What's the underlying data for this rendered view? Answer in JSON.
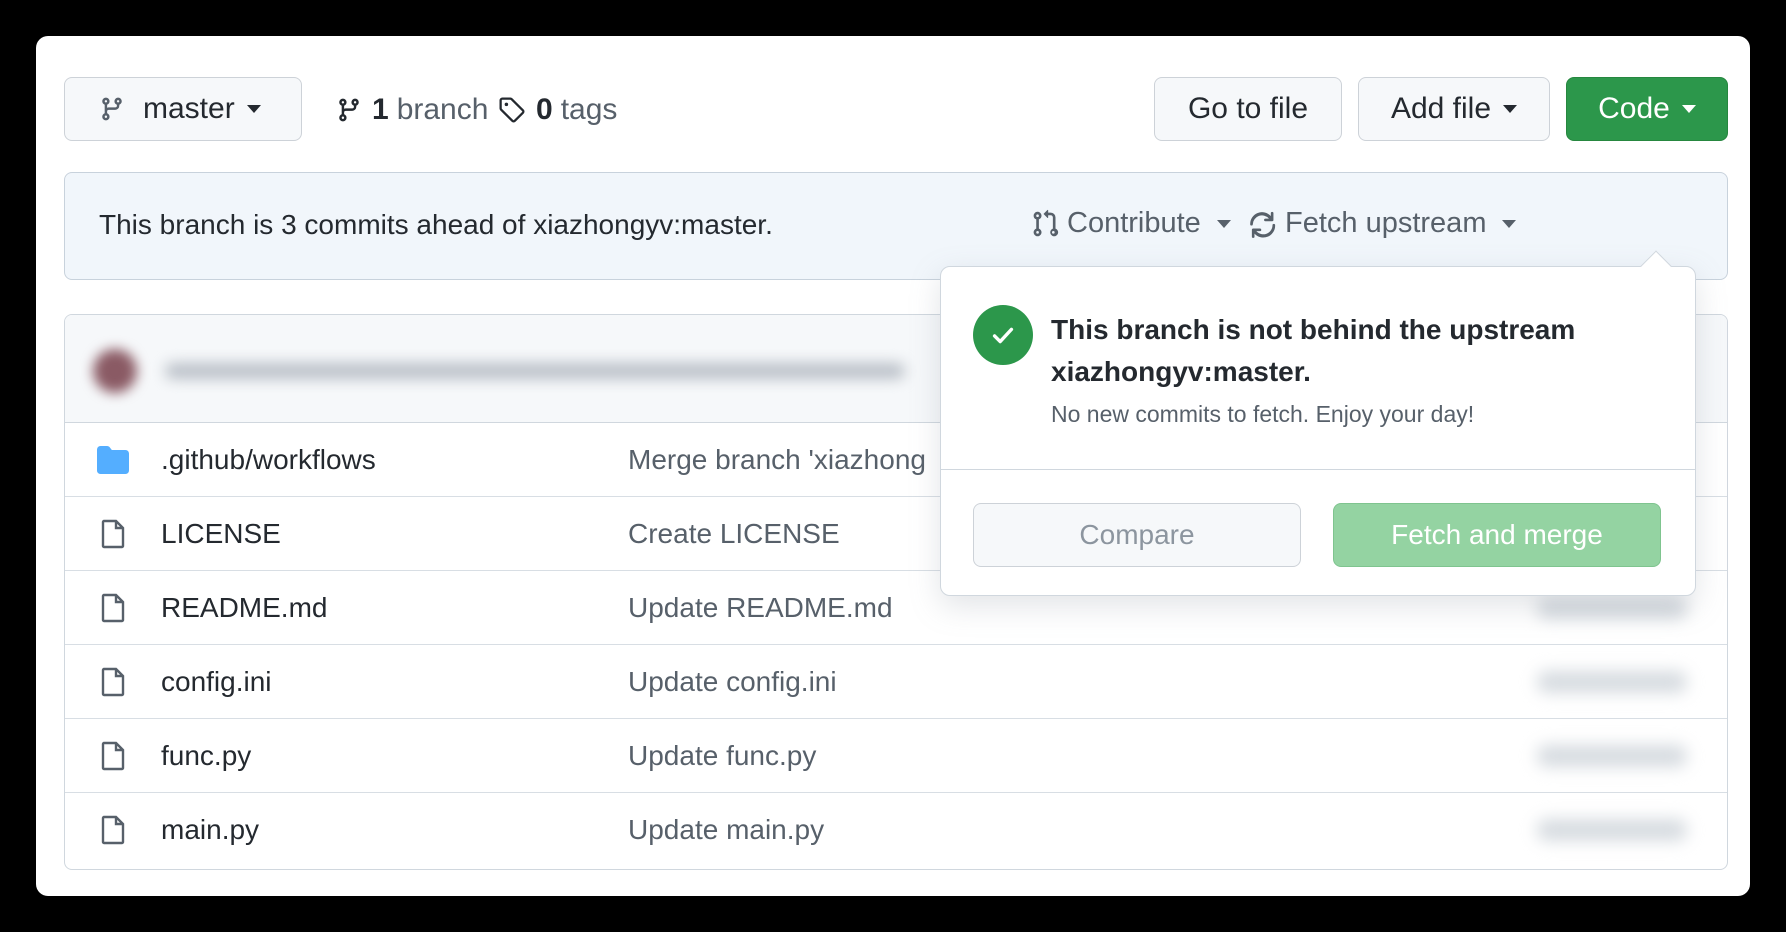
{
  "toolbar": {
    "branch_label": "master",
    "branch_count": "1",
    "branch_word": "branch",
    "tag_count": "0",
    "tag_word": "tags",
    "goto_label": "Go to file",
    "addfile_label": "Add file",
    "code_label": "Code"
  },
  "ahead_bar": {
    "text": "This branch is 3 commits ahead of xiazhongyv:master.",
    "contribute_label": "Contribute",
    "fetch_label": "Fetch upstream"
  },
  "files": [
    {
      "name": ".github/workflows",
      "message": "Merge branch 'xiazhong",
      "type": "folder"
    },
    {
      "name": "LICENSE",
      "message": "Create LICENSE",
      "type": "file"
    },
    {
      "name": "README.md",
      "message": "Update README.md",
      "type": "file"
    },
    {
      "name": "config.ini",
      "message": "Update config.ini",
      "type": "file"
    },
    {
      "name": "func.py",
      "message": "Update func.py",
      "type": "file"
    },
    {
      "name": "main.py",
      "message": "Update main.py",
      "type": "file"
    }
  ],
  "popover": {
    "title_line1": "This branch is not behind the upstream",
    "title_line2": "xiazhongyv:master.",
    "subtitle": "No new commits to fetch. Enjoy your day!",
    "compare_label": "Compare",
    "fetch_merge_label": "Fetch and merge"
  },
  "colors": {
    "primary_green": "#2c974b",
    "disabled_green": "#94d3a2",
    "folder_blue": "#54aeff"
  }
}
